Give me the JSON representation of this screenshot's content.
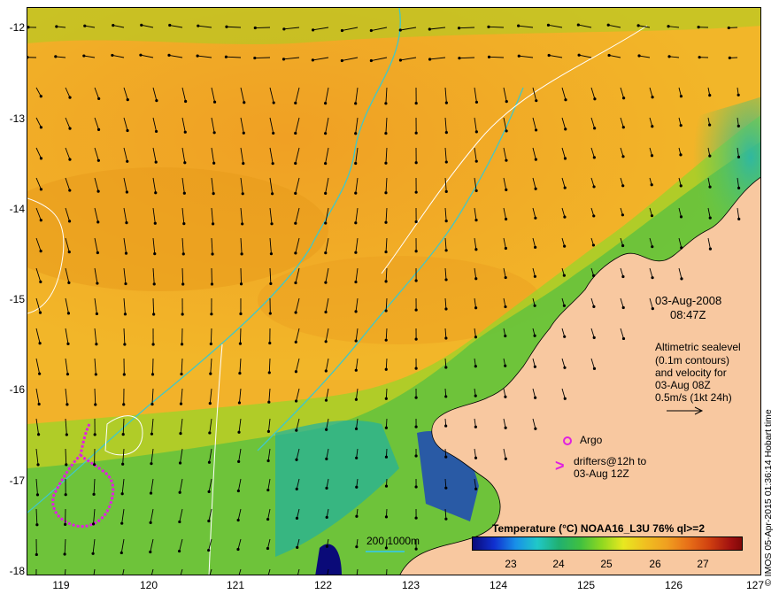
{
  "map": {
    "lon_range": [
      118.6,
      127.0
    ],
    "lat_range": [
      -18.0,
      -11.7
    ],
    "x_ticks": [
      "119",
      "120",
      "121",
      "122",
      "123",
      "124",
      "125",
      "126",
      "127"
    ],
    "y_ticks": [
      "-12",
      "-13",
      "-14",
      "-15",
      "-16",
      "-17",
      "-18"
    ]
  },
  "overlay": {
    "date": "03-Aug-2008",
    "time": "08:47Z",
    "altimetry_lines": [
      "Altimetric sealevel",
      "(0.1m contours)",
      "and velocity for",
      "03-Aug 08Z",
      "0.5m/s (1kt 24h)"
    ],
    "argo_label": "Argo",
    "drifters_label_1": "drifters@12h to",
    "drifters_label_2": "03-Aug 12Z",
    "depth_scale": "200  1000m"
  },
  "colorbar": {
    "title": "Temperature (°C) NOAA16_L3U 76% ql>=2",
    "ticks": [
      "23",
      "24",
      "25",
      "26",
      "27"
    ]
  },
  "credit": "© IMOS 05-Apr-2015 01:36:14 Hobart time",
  "colors": {
    "land": "#f8c8a0",
    "warm_sst": "#f0b020",
    "cool_sst": "#40c040",
    "coastal_cold": "#1030d0",
    "isobath": "#40c8c8",
    "drifter": "#e020e0"
  }
}
